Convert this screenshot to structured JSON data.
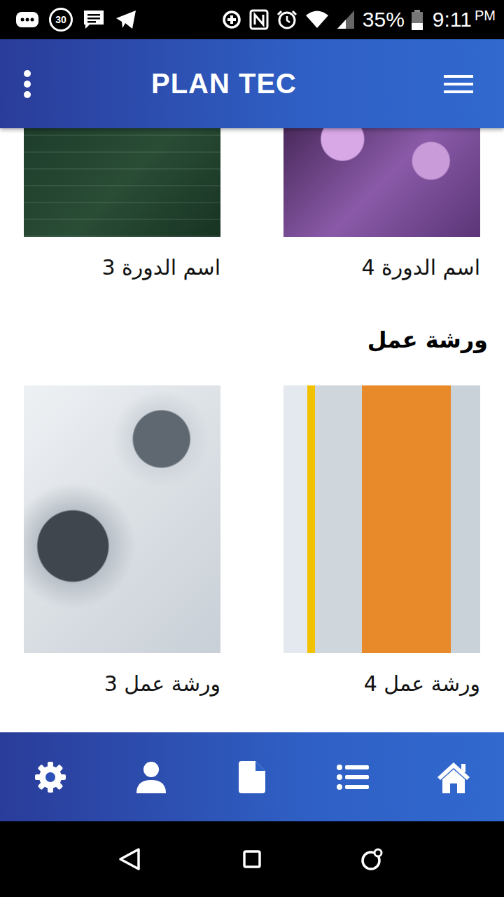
{
  "status_bar": {
    "notification_count": "30",
    "battery": "35%",
    "battery_level": 0.35,
    "time": "9:11",
    "period": "PM"
  },
  "app_bar": {
    "title": "PLAN TEC"
  },
  "sections": [
    {
      "items": [
        {
          "label": "اسم الدورة 4"
        },
        {
          "label": "اسم الدورة 3"
        }
      ]
    },
    {
      "title": "ورشة عمل",
      "items": [
        {
          "label": "ورشة عمل 4"
        },
        {
          "label": "ورشة عمل 3"
        }
      ]
    }
  ]
}
